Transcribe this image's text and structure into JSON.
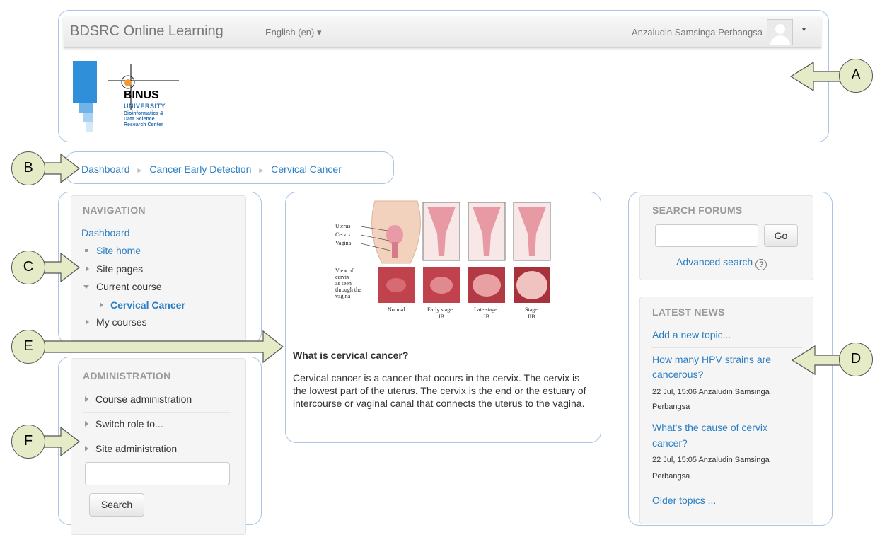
{
  "header": {
    "brand": "BDSRC Online Learning",
    "language": "English (en) ▾",
    "user_name": "Anzaludin Samsinga Perbangsa",
    "caret": "▾"
  },
  "logo": {
    "word": "BINUS",
    "sub": "UNIVERSITY",
    "lines": [
      "Bioinformatics &",
      "Data Science",
      "Research Center"
    ]
  },
  "breadcrumb": {
    "items": [
      "Dashboard",
      "Cancer Early Detection",
      "Cervical Cancer"
    ],
    "separator": "►"
  },
  "navigation": {
    "title": "NAVIGATION",
    "dashboard": "Dashboard",
    "site_home": "Site home",
    "site_pages": "Site pages",
    "current_course": "Current course",
    "course": "Cervical Cancer",
    "my_courses": "My courses"
  },
  "administration": {
    "title": "ADMINISTRATION",
    "items": [
      "Course administration",
      "Switch role to...",
      "Site administration"
    ],
    "search_value": "",
    "search_button": "Search"
  },
  "main": {
    "image_labels": {
      "anatomy": [
        "Uterus",
        "Cervix",
        "Vagina"
      ],
      "view_caption": [
        "View of",
        "cervix",
        "as seen",
        "through the",
        "vagina"
      ],
      "stages": [
        {
          "line1": "Normal",
          "line2": ""
        },
        {
          "line1": "Early stage",
          "line2": "IB"
        },
        {
          "line1": "Late stage",
          "line2": "IB"
        },
        {
          "line1": "Stage",
          "line2": "IIB"
        }
      ]
    },
    "heading": "What is cervical cancer?",
    "text": "Cervical cancer is a cancer that occurs in the cervix. The cervix is the lowest part of the uterus. The cervix is the end or the estuary of intercourse or vaginal canal that connects the uterus to the vagina."
  },
  "search_forums": {
    "title": "SEARCH FORUMS",
    "input_value": "",
    "go": "Go",
    "advanced": "Advanced search",
    "help": "?"
  },
  "latest_news": {
    "title": "LATEST NEWS",
    "add": "Add a new topic...",
    "items": [
      {
        "title_1": "How many HPV strains are",
        "title_2": "cancerous?",
        "meta_1": "22 Jul, 15:06 Anzaludin Samsinga",
        "meta_2": "Perbangsa"
      },
      {
        "title_1": "What's the cause of cervix",
        "title_2": "cancer?",
        "meta_1": "22 Jul, 15:05 Anzaludin Samsinga",
        "meta_2": "Perbangsa"
      }
    ],
    "older": "Older topics ..."
  },
  "callouts": {
    "a": "A",
    "b": "B",
    "c": "C",
    "d": "D",
    "e": "E",
    "f": "F"
  },
  "colors": {
    "link": "#2a7ec4",
    "callout_fill": "#e5ebc6",
    "box_border": "#a9c4e4"
  }
}
